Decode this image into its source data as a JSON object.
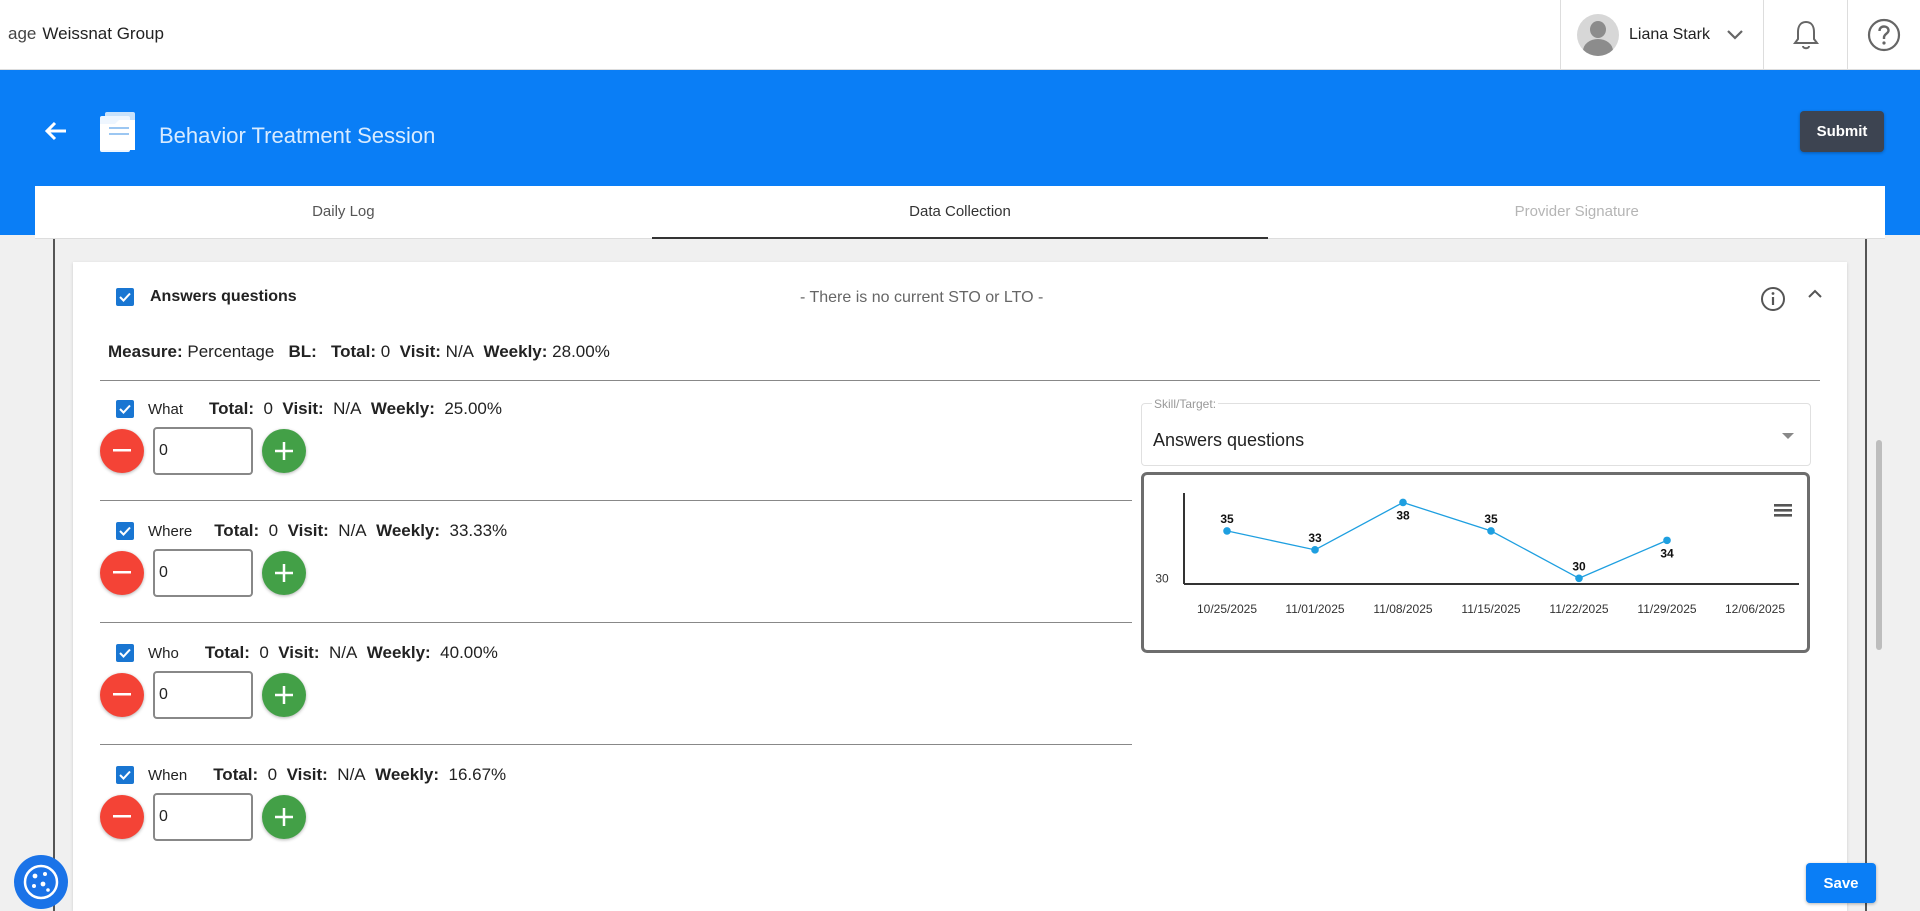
{
  "topbar": {
    "logo_alt": "age",
    "org_name": "Weissnat Group",
    "user_name": "Liana Stark"
  },
  "header": {
    "title": "Behavior Treatment Session",
    "submit_label": "Submit"
  },
  "tabs": [
    {
      "label": "Daily Log",
      "state": "normal"
    },
    {
      "label": "Data Collection",
      "state": "active"
    },
    {
      "label": "Provider Signature",
      "state": "disabled"
    }
  ],
  "goal": {
    "title": "Answers questions",
    "note": "-   There is no current STO or LTO   -",
    "checked": true
  },
  "measure": {
    "measure_label": "Measure:",
    "measure_value": "Percentage",
    "bl_label": "BL:",
    "total_label": "Total:",
    "total_value": "0",
    "visit_label": "Visit:",
    "visit_value": "N/A",
    "weekly_label": "Weekly:",
    "weekly_value": "28.00%"
  },
  "targets": [
    {
      "label": "What",
      "total_label": "Total:",
      "total": "0",
      "visit_label": "Visit:",
      "visit": "N/A",
      "weekly_label": "Weekly:",
      "weekly": "25.00%",
      "count": "0"
    },
    {
      "label": "Where",
      "total_label": "Total:",
      "total": "0",
      "visit_label": "Visit:",
      "visit": "N/A",
      "weekly_label": "Weekly:",
      "weekly": "33.33%",
      "count": "0"
    },
    {
      "label": "Who",
      "total_label": "Total:",
      "total": "0",
      "visit_label": "Visit:",
      "visit": "N/A",
      "weekly_label": "Weekly:",
      "weekly": "40.00%",
      "count": "0"
    },
    {
      "label": "When",
      "total_label": "Total:",
      "total": "0",
      "visit_label": "Visit:",
      "visit": "N/A",
      "weekly_label": "Weekly:",
      "weekly": "16.67%",
      "count": "0"
    }
  ],
  "skill_select": {
    "legend": "Skill/Target:",
    "value": "Answers questions"
  },
  "chart_data": {
    "type": "line",
    "x": [
      "10/25/2025",
      "11/01/2025",
      "11/08/2025",
      "11/15/2025",
      "11/22/2025",
      "11/29/2025",
      "12/06/2025"
    ],
    "series": [
      {
        "values": [
          35,
          33,
          38,
          35,
          30,
          34,
          null
        ]
      }
    ],
    "y_ticks": [
      30
    ],
    "ylim": [
      29.5,
      39
    ],
    "data_labels": true,
    "color": "#1e9fe0",
    "grid": false
  },
  "footer": {
    "save_label": "Save"
  },
  "colors": {
    "header_blue": "#0a7ef6",
    "minus_red": "#f44336",
    "plus_green": "#43a047",
    "checkbox_blue": "#1976d2"
  }
}
